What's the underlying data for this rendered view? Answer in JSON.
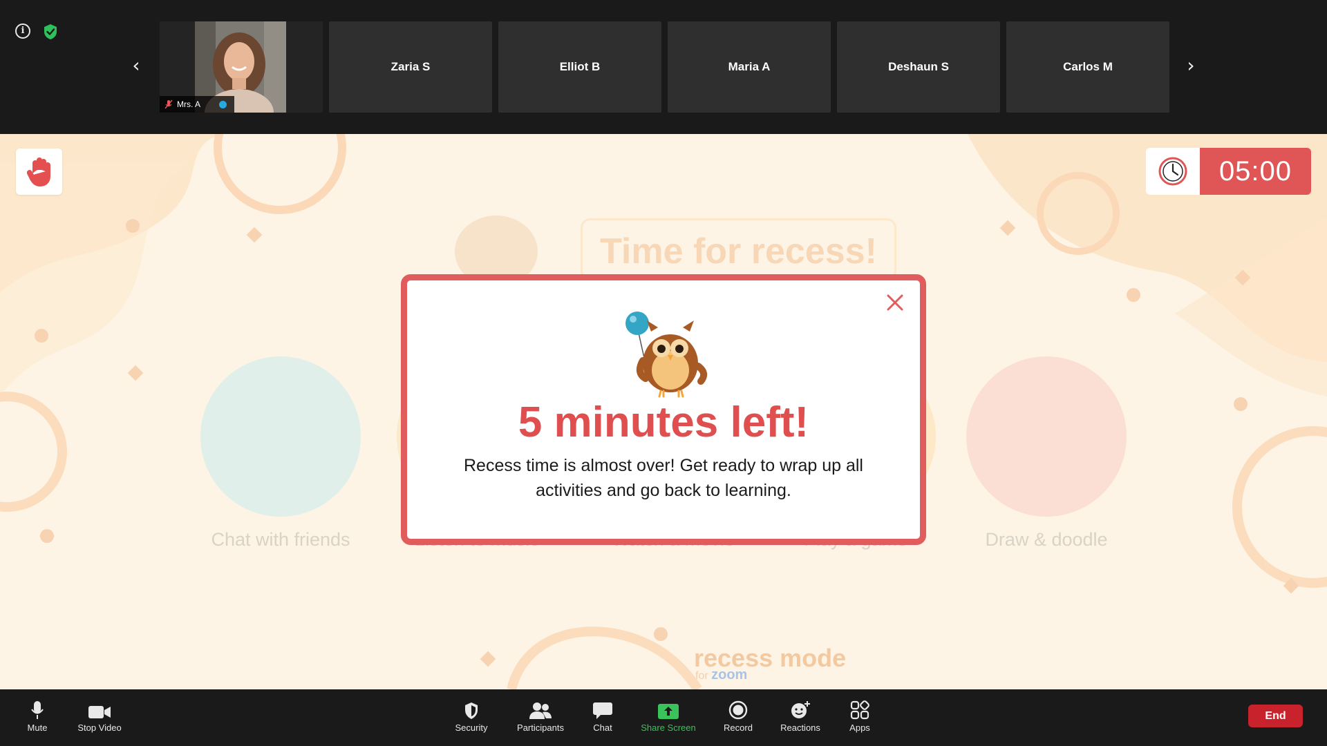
{
  "participants_strip": {
    "self": {
      "name": "Mrs. A",
      "mic_state": "muted"
    },
    "participants": [
      "Zaria S",
      "Elliot B",
      "Maria A",
      "Deshaun S",
      "Carlos M"
    ],
    "prev_icon": "chevron-left-icon",
    "next_icon": "chevron-right-icon"
  },
  "stage": {
    "raise_hand_icon": "raised-hand-icon",
    "timer": {
      "value": "05:00",
      "icon": "clock-icon",
      "accent": "#e05656"
    },
    "background_title": "Time for recess!",
    "activities": [
      {
        "label": "Chat with friends",
        "icon": "seal-icon",
        "color": "#dcefe9"
      },
      {
        "label": "Listen to music",
        "icon": "music-icon",
        "color": "#fde6c2"
      },
      {
        "label": "Watch a movie",
        "icon": "movie-icon",
        "color": "#fde6c2"
      },
      {
        "label": "Play a game",
        "icon": "game-icon",
        "color": "#fde6c2"
      },
      {
        "label": "Draw & doodle",
        "icon": "red-panda-icon",
        "color": "#fbdcd2"
      }
    ],
    "watermark": {
      "brand": "recess mode",
      "sub_prefix": "for",
      "sub_brand": "zoom"
    }
  },
  "modal": {
    "title": "5 minutes left!",
    "body": "Recess time is almost over! Get ready to wrap up all activities and go back to learning.",
    "icon": "owl-with-balloon-icon",
    "close_icon": "close-icon",
    "accent": "#e15c5c"
  },
  "toolbar": {
    "mute_label": "Mute",
    "stop_video_label": "Stop Video",
    "security_label": "Security",
    "participants_label": "Participants",
    "chat_label": "Chat",
    "share_screen_label": "Share Screen",
    "record_label": "Record",
    "reactions_label": "Reactions",
    "apps_label": "Apps",
    "end_label": "End",
    "share_color": "#39c35a",
    "end_color": "#c8232d"
  }
}
